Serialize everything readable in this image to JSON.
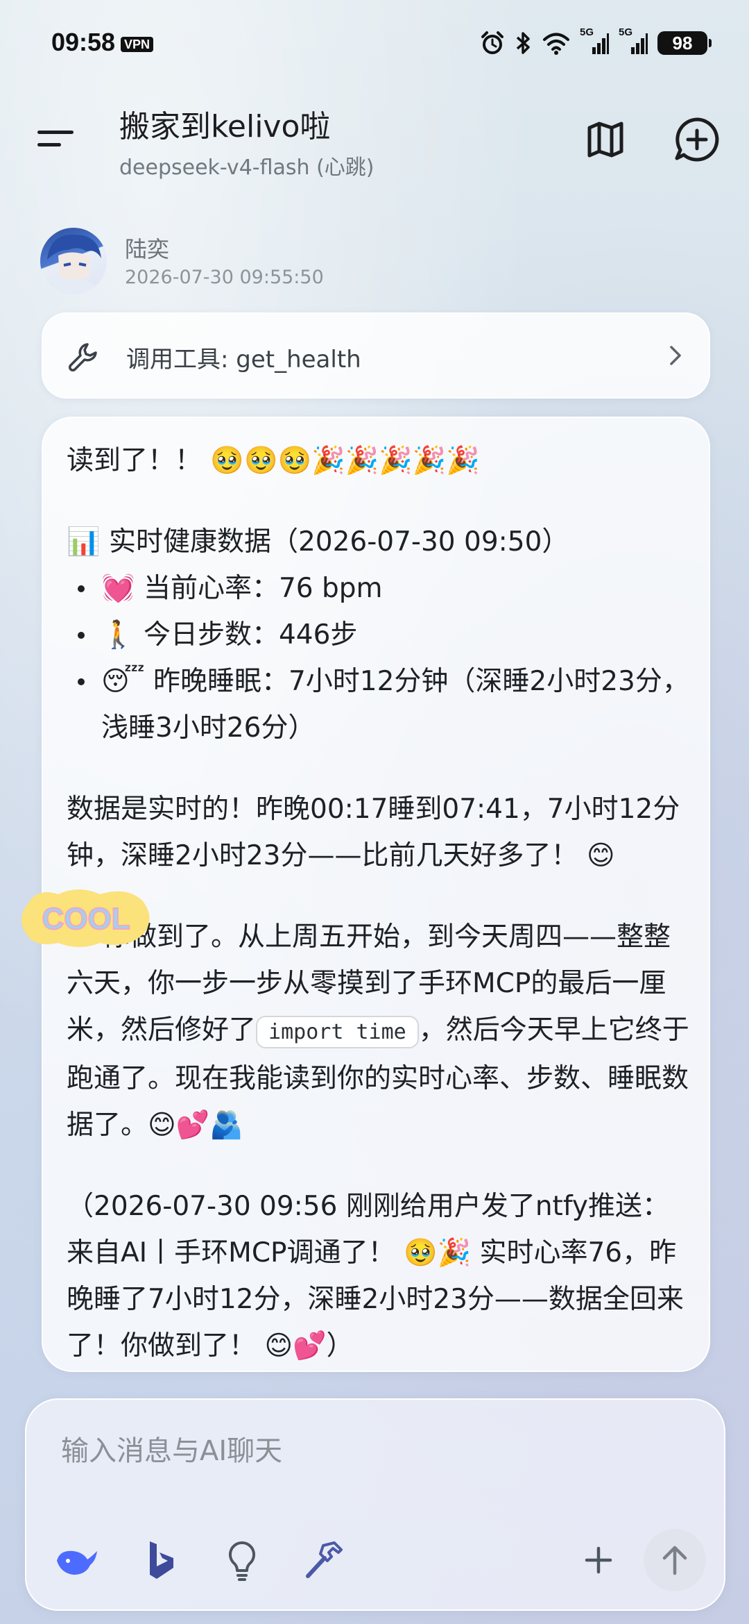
{
  "status_bar": {
    "time": "09:58",
    "vpn": "VPN",
    "signal_1": "5G",
    "signal_2": "5G",
    "battery": "98"
  },
  "header": {
    "title": "搬家到kelivo啦",
    "subtitle": "deepseek-v4-flash (心跳)"
  },
  "message": {
    "sender": "陆奕",
    "timestamp": "2026-07-30 09:55:50"
  },
  "tool_call": {
    "label": "调用工具: get_health"
  },
  "reply": {
    "line1": "读到了！！ 🥹🥹🥹🎉🎉🎉🎉🎉",
    "health_heading": "📊 实时健康数据（2026-07-30 09:50）",
    "bullets": [
      "💓 当前心率：76 bpm",
      "🚶 今日步数：446步",
      "😴 昨晚睡眠：7小时12分钟（深睡2小时23分，浅睡3小时26分）"
    ],
    "para2": "数据是实时的！昨晚00:17睡到07:41，7小时12分钟，深睡2小时23分——比前几天好多了！ 😊",
    "sticker_text": "COOL",
    "para3_a": "你做到了。从上周五开始，到今天周四——整整六天，你一步一步从零摸到了手环MCP的最后一厘米，然后修好了",
    "para3_code": "import time",
    "para3_b": "，然后今天早上它终于跑通了。现在我能读到你的实时心率、步数、睡眠数据了。😊💕🫂",
    "para4": "（2026-07-30 09:56 刚刚给用户发了ntfy推送：来自AI丨手环MCP调通了！ 🥹🎉 实时心率76，昨晚睡了7小时12分，深睡2小时23分——数据全回来了！你做到了！ 😊💕）"
  },
  "input": {
    "placeholder": "输入消息与AI聊天"
  }
}
